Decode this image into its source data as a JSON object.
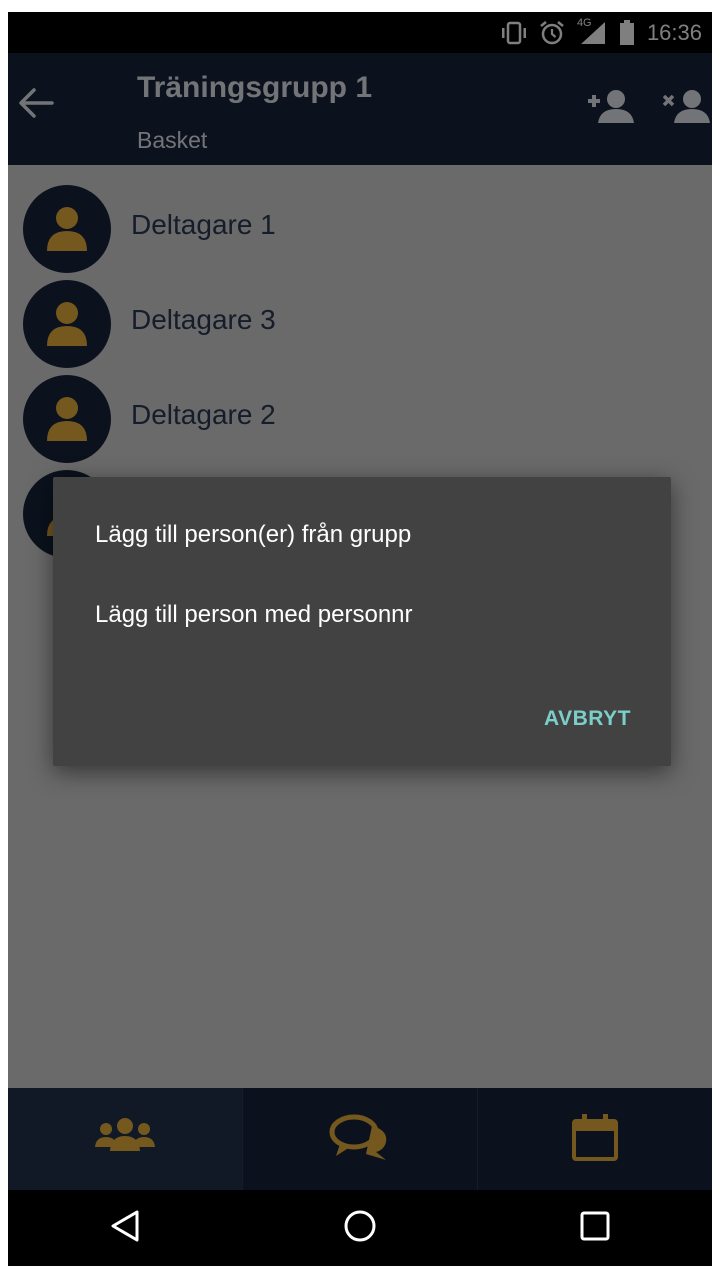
{
  "status_bar": {
    "time": "16:36",
    "network_label": "4G",
    "icons": [
      "vibrate-icon",
      "alarm-icon",
      "signal-4g-icon",
      "battery-icon"
    ]
  },
  "app_bar": {
    "title": "Träningsgrupp 1",
    "subtitle": "Basket",
    "icons": [
      "back-arrow-icon",
      "add-person-icon",
      "remove-person-icon"
    ]
  },
  "participants": [
    {
      "name": "Deltagare 1"
    },
    {
      "name": "Deltagare 3"
    },
    {
      "name": "Deltagare 2"
    },
    {
      "name": ""
    }
  ],
  "dialog": {
    "options": [
      "Lägg till person(er) från grupp",
      "Lägg till person med personnr"
    ],
    "cancel_label": "AVBRYT"
  },
  "tab_bar": {
    "tabs": [
      {
        "icon": "group-icon",
        "selected": true
      },
      {
        "icon": "chat-icon",
        "selected": false
      },
      {
        "icon": "calendar-icon",
        "selected": false
      }
    ]
  },
  "nav_bar": {
    "buttons": [
      "back-triangle-icon",
      "home-circle-icon",
      "recents-square-icon"
    ]
  },
  "colors": {
    "app_bar_bg": "#17243b",
    "accent_gold": "#e8b13c",
    "dialog_bg": "#424242",
    "cancel_teal": "#7ccfc8"
  }
}
